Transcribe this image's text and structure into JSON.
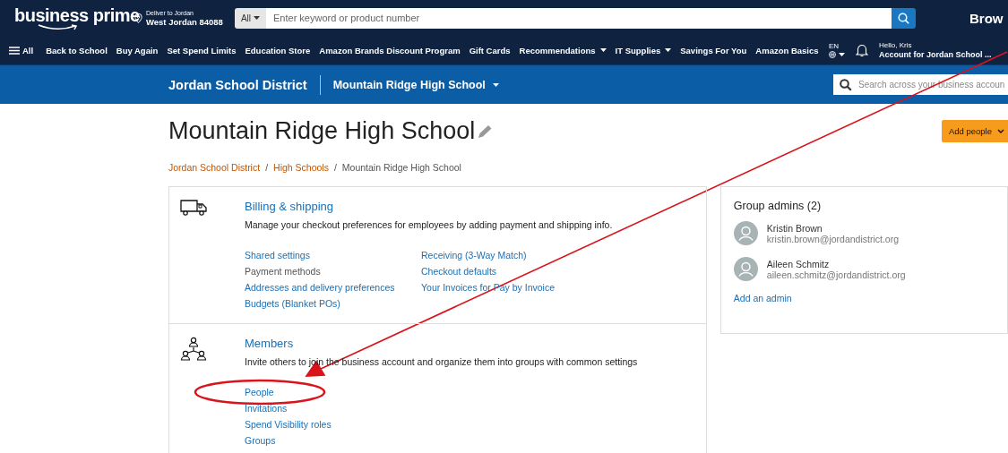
{
  "header": {
    "logo": "business prime",
    "deliver_label": "Deliver to Jordan",
    "deliver_location": "West Jordan 84088",
    "search_category": "All",
    "search_placeholder": "Enter keyword or product number",
    "account_name": "Brow"
  },
  "nav": {
    "menu_label": "All",
    "items": [
      {
        "label": "Back to School",
        "dropdown": false
      },
      {
        "label": "Buy Again",
        "dropdown": false
      },
      {
        "label": "Set Spend Limits",
        "dropdown": false
      },
      {
        "label": "Education Store",
        "dropdown": false
      },
      {
        "label": "Amazon Brands Discount Program",
        "dropdown": false
      },
      {
        "label": "Gift Cards",
        "dropdown": false
      },
      {
        "label": "Recommendations",
        "dropdown": true
      },
      {
        "label": "IT Supplies",
        "dropdown": true
      },
      {
        "label": "Savings For You",
        "dropdown": false
      },
      {
        "label": "Amazon Basics",
        "dropdown": false
      }
    ],
    "language": "EN",
    "greeting": "Hello, Kris",
    "account": "Account for Jordan School ..."
  },
  "org_bar": {
    "district": "Jordan School District",
    "school": "Mountain Ridge High School",
    "search_placeholder": "Search across your business accoun"
  },
  "page": {
    "title": "Mountain Ridge High School",
    "action": "Add people",
    "breadcrumb_separators": [
      "/",
      "/"
    ],
    "breadcrumb": [
      {
        "label": "Jordan School District",
        "link": true
      },
      {
        "label": "High Schools",
        "link": true
      },
      {
        "label": "Mountain Ridge High School",
        "link": false
      }
    ]
  },
  "sections": [
    {
      "kind": "truck",
      "title": "Billing & shipping",
      "description": "Manage your checkout preferences for employees by adding payment and shipping info.",
      "columns": [
        [
          {
            "label": "Shared settings",
            "disabled": false
          },
          {
            "label": "Payment methods",
            "disabled": true
          },
          {
            "label": "Addresses and delivery preferences",
            "disabled": false
          },
          {
            "label": "Budgets (Blanket POs)",
            "disabled": false
          }
        ],
        [
          {
            "label": "Receiving (3-Way Match)",
            "disabled": false
          },
          {
            "label": "Checkout defaults",
            "disabled": false
          },
          {
            "label": "Your Invoices for Pay by Invoice",
            "disabled": false
          }
        ]
      ]
    },
    {
      "kind": "people",
      "title": "Members",
      "description": "Invite others to join the business account and organize them into groups with common settings",
      "columns": [
        [
          {
            "label": "People",
            "disabled": false
          },
          {
            "label": "Invitations",
            "disabled": false
          },
          {
            "label": "Spend Visibility roles",
            "disabled": false
          },
          {
            "label": "Groups",
            "disabled": false
          }
        ]
      ]
    }
  ],
  "admins": {
    "title": "Group admins (2)",
    "people": [
      {
        "name": "Kristin Brown",
        "email": "kristin.brown@jordandistrict.org"
      },
      {
        "name": "Aileen Schmitz",
        "email": "aileen.schmitz@jordandistrict.org"
      }
    ],
    "add_link": "Add an admin"
  }
}
